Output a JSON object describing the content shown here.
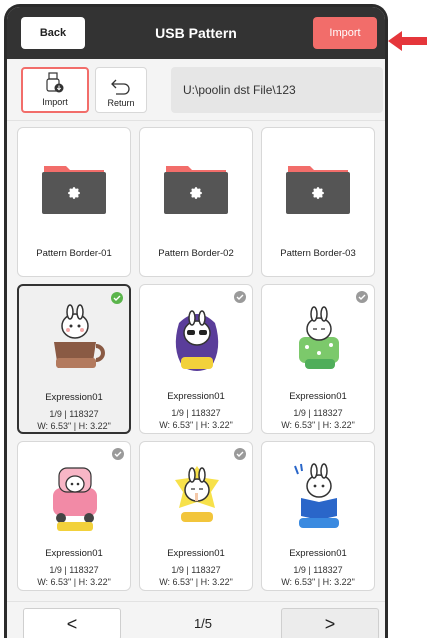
{
  "header": {
    "back_label": "Back",
    "title": "USB Pattern",
    "import_label": "Import"
  },
  "toolbar": {
    "import_label": "Import",
    "return_label": "Return",
    "path": "U:\\poolin dst File\\123"
  },
  "folders": [
    {
      "name": "Pattern Border-01"
    },
    {
      "name": "Pattern Border-02"
    },
    {
      "name": "Pattern Border-03"
    }
  ],
  "items": [
    {
      "name": "Expression01",
      "info1": "1/9 | 118327",
      "info2": "W: 6.53\" | H: 3.22\"",
      "selected": true,
      "art": "COFFEE"
    },
    {
      "name": "Expression01",
      "info1": "1/9 | 118327",
      "info2": "W: 6.53\" | H: 3.22\"",
      "selected": false,
      "art": "COOL"
    },
    {
      "name": "Expression01",
      "info1": "1/9 | 118327",
      "info2": "W: 6.53\" | H: 3.22\"",
      "selected": false,
      "art": "SLEEP"
    },
    {
      "name": "Expression01",
      "info1": "1/9 | 118327",
      "info2": "W: 6.53\" | H: 3.22\"",
      "selected": false,
      "art": "OUTING"
    },
    {
      "name": "Expression01",
      "info1": "1/9 | 118327",
      "info2": "W: 6.53\" | H: 3.22\"",
      "selected": false,
      "art": "SHHH"
    },
    {
      "name": "Expression01",
      "info1": "1/9 | 118327",
      "info2": "W: 6.53\" | H: 3.22\"",
      "selected": false,
      "art": "LEARNING"
    }
  ],
  "pager": {
    "prev_label": "<",
    "page": "1/5",
    "next_label": ">"
  },
  "colors": {
    "accent": "#f26d6a",
    "header": "#333333",
    "check_on": "#5ab44b",
    "check_off": "#9a9a9a"
  }
}
